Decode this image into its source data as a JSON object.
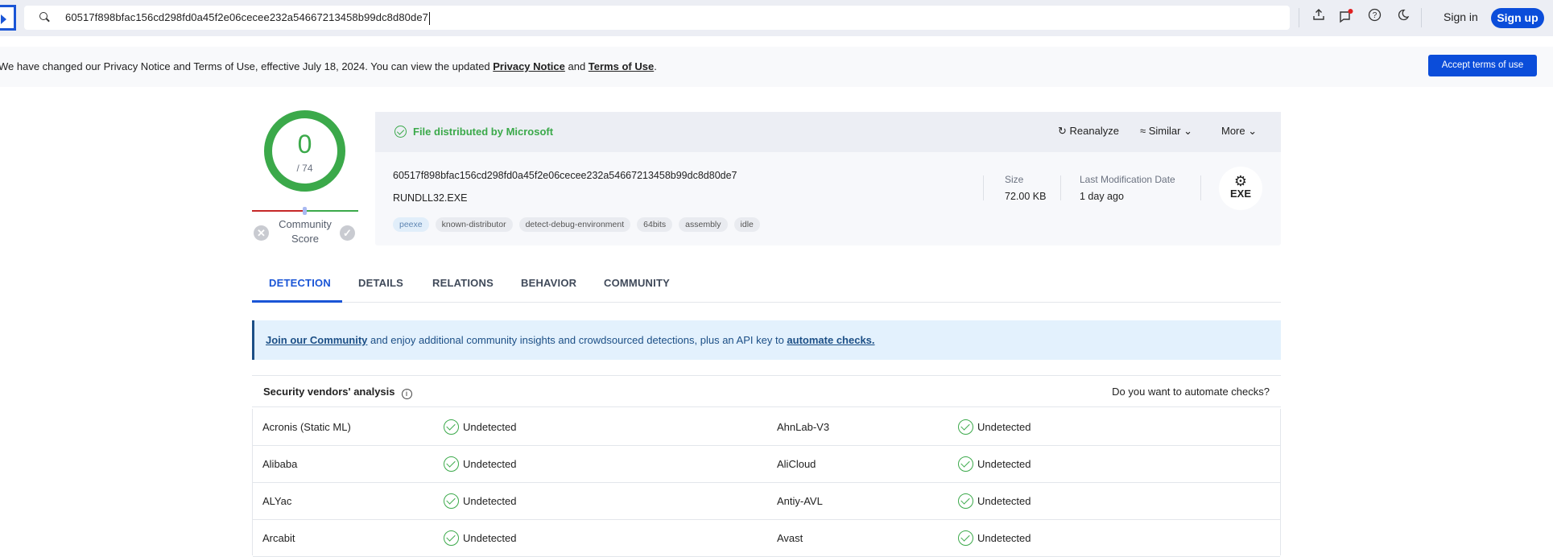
{
  "topbar": {
    "search_value": "60517f898bfac156cd298fd0a45f2e06cecee232a54667213458b99dc8d80de7",
    "icons": [
      "upload-icon",
      "chat-icon",
      "help-icon",
      "dark-mode-icon"
    ],
    "sign_in": "Sign in",
    "sign_up": "Sign up",
    "notification_dot_color": "#e02020"
  },
  "notice": {
    "text_before": "We have changed our Privacy Notice and Terms of Use, effective July 18, 2024. You can view the updated ",
    "privacy_link": "Privacy Notice",
    "text_mid": " and ",
    "terms_link": "Terms of Use",
    "text_after": ".",
    "accept_button": "Accept terms of use"
  },
  "score": {
    "detections": "0",
    "total": "/ 74",
    "community_label_1": "Community",
    "community_label_2": "Score",
    "accent": "#3ba94a"
  },
  "summary": {
    "distributor": "File distributed by Microsoft",
    "actions": {
      "reanalyze": "Reanalyze",
      "similar": "Similar",
      "more": "More"
    },
    "hash": "60517f898bfac156cd298fd0a45f2e06cecee232a54667213458b99dc8d80de7",
    "filename": "RUNDLL32.EXE",
    "tags": [
      "peexe",
      "known-distributor",
      "detect-debug-environment",
      "64bits",
      "assembly",
      "idle"
    ],
    "size_label": "Size",
    "size_value": "72.00 KB",
    "date_label": "Last Modification Date",
    "date_value": "1 day ago",
    "file_type": "EXE"
  },
  "tabs": [
    "DETECTION",
    "DETAILS",
    "RELATIONS",
    "BEHAVIOR",
    "COMMUNITY"
  ],
  "banner": {
    "link1": "Join our Community",
    "text": " and enjoy additional community insights and crowdsourced detections, plus an API key to ",
    "link2": "automate checks."
  },
  "vendors": {
    "title": "Security vendors' analysis",
    "automate": "Do you want to automate checks?",
    "rows": [
      [
        {
          "name": "Acronis (Static ML)",
          "result": "Undetected"
        },
        {
          "name": "AhnLab-V3",
          "result": "Undetected"
        }
      ],
      [
        {
          "name": "Alibaba",
          "result": "Undetected"
        },
        {
          "name": "AliCloud",
          "result": "Undetected"
        }
      ],
      [
        {
          "name": "ALYac",
          "result": "Undetected"
        },
        {
          "name": "Antiy-AVL",
          "result": "Undetected"
        }
      ],
      [
        {
          "name": "Arcabit",
          "result": "Undetected"
        },
        {
          "name": "Avast",
          "result": "Undetected"
        }
      ]
    ]
  }
}
